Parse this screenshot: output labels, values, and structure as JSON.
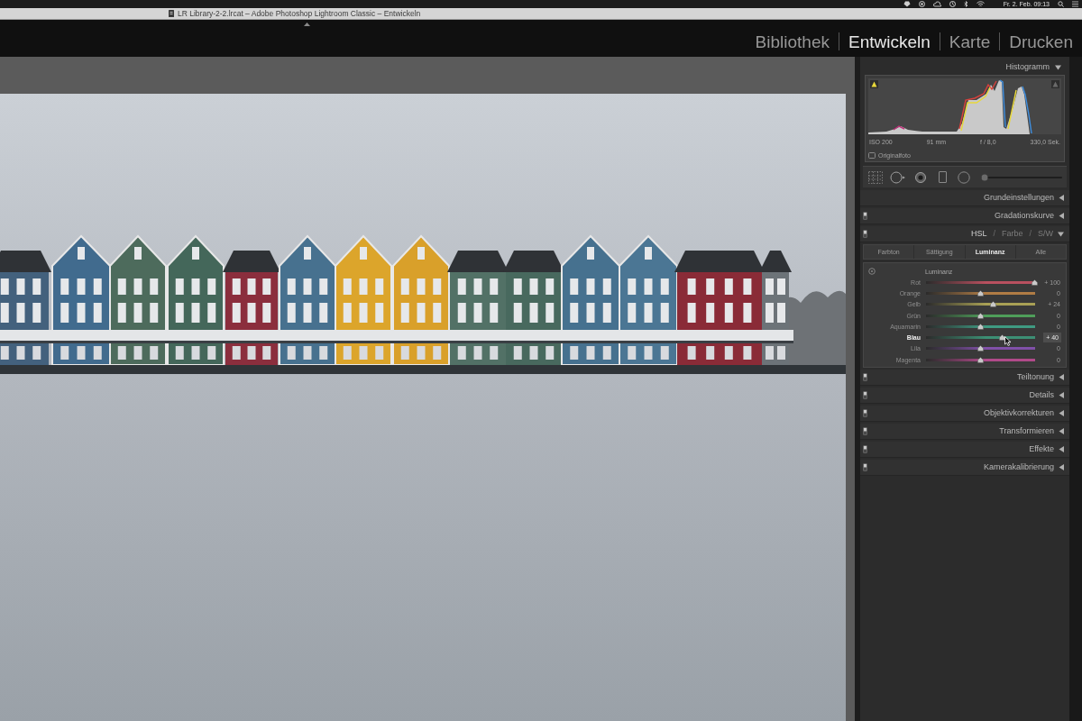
{
  "menu_bar": {
    "clock": "Fr. 2. Feb. 09:13"
  },
  "window": {
    "title": "LR Library-2-2.lrcat – Adobe Photoshop Lightroom Classic – Entwickeln"
  },
  "module_picker": [
    {
      "label": "Bibliothek",
      "selected": false
    },
    {
      "label": "Entwickeln",
      "selected": true
    },
    {
      "label": "Karte",
      "selected": false
    },
    {
      "label": "Drucken",
      "selected": false
    }
  ],
  "histogram": {
    "title": "Histogramm",
    "expanded": true,
    "shadow_clipping": true,
    "highlight_clipping": false,
    "info": [
      "ISO 200",
      "91 mm",
      "f / 8,0",
      "330,0 Sek."
    ],
    "original_photo": {
      "label": "Originalfoto",
      "checked": false
    }
  },
  "panels_top": [
    {
      "label": "Grundeinstellungen",
      "expanded": false,
      "switch": false
    },
    {
      "label": "Gradationskurve",
      "expanded": false,
      "switch": true
    }
  ],
  "hsl_panel": {
    "modes": [
      {
        "label": "HSL",
        "selected": true
      },
      {
        "label": "Farbe",
        "selected": false
      },
      {
        "label": "S/W",
        "selected": false
      }
    ],
    "separator": "/",
    "expanded": true,
    "switch": true,
    "tabs": [
      {
        "label": "Farbton",
        "selected": false
      },
      {
        "label": "Sättigung",
        "selected": false
      },
      {
        "label": "Luminanz",
        "selected": true
      },
      {
        "label": "Alle",
        "selected": false
      }
    ],
    "section_title": "Luminanz",
    "sliders": [
      {
        "label": "Rot",
        "value": "+ 100",
        "level": 1,
        "color": "#b8505f",
        "active": false
      },
      {
        "label": "Orange",
        "value": "0",
        "level": 0.5,
        "color": "#b07c45",
        "active": false
      },
      {
        "label": "Gelb",
        "value": "+ 24",
        "level": 0.62,
        "color": "#a8a055",
        "active": false
      },
      {
        "label": "Grün",
        "value": "0",
        "level": 0.5,
        "color": "#4f9e5a",
        "active": false
      },
      {
        "label": "Aquamarin",
        "value": "0",
        "level": 0.5,
        "color": "#3f9a82",
        "active": false
      },
      {
        "label": "Blau",
        "value": "+ 40",
        "level": 0.7,
        "color": "#3c8f74",
        "active": true
      },
      {
        "label": "Lila",
        "value": "0",
        "level": 0.5,
        "color": "#8050a8",
        "active": false
      },
      {
        "label": "Magenta",
        "value": "0",
        "level": 0.5,
        "color": "#b04a8a",
        "active": false
      }
    ]
  },
  "panels_bottom": [
    {
      "label": "Teiltonung",
      "expanded": false,
      "switch": true
    },
    {
      "label": "Details",
      "expanded": false,
      "switch": true
    },
    {
      "label": "Objektivkorrekturen",
      "expanded": false,
      "switch": true
    },
    {
      "label": "Transformieren",
      "expanded": false,
      "switch": true
    },
    {
      "label": "Effekte",
      "expanded": false,
      "switch": true
    },
    {
      "label": "Kamerakalibrierung",
      "expanded": false,
      "switch": true
    }
  ]
}
